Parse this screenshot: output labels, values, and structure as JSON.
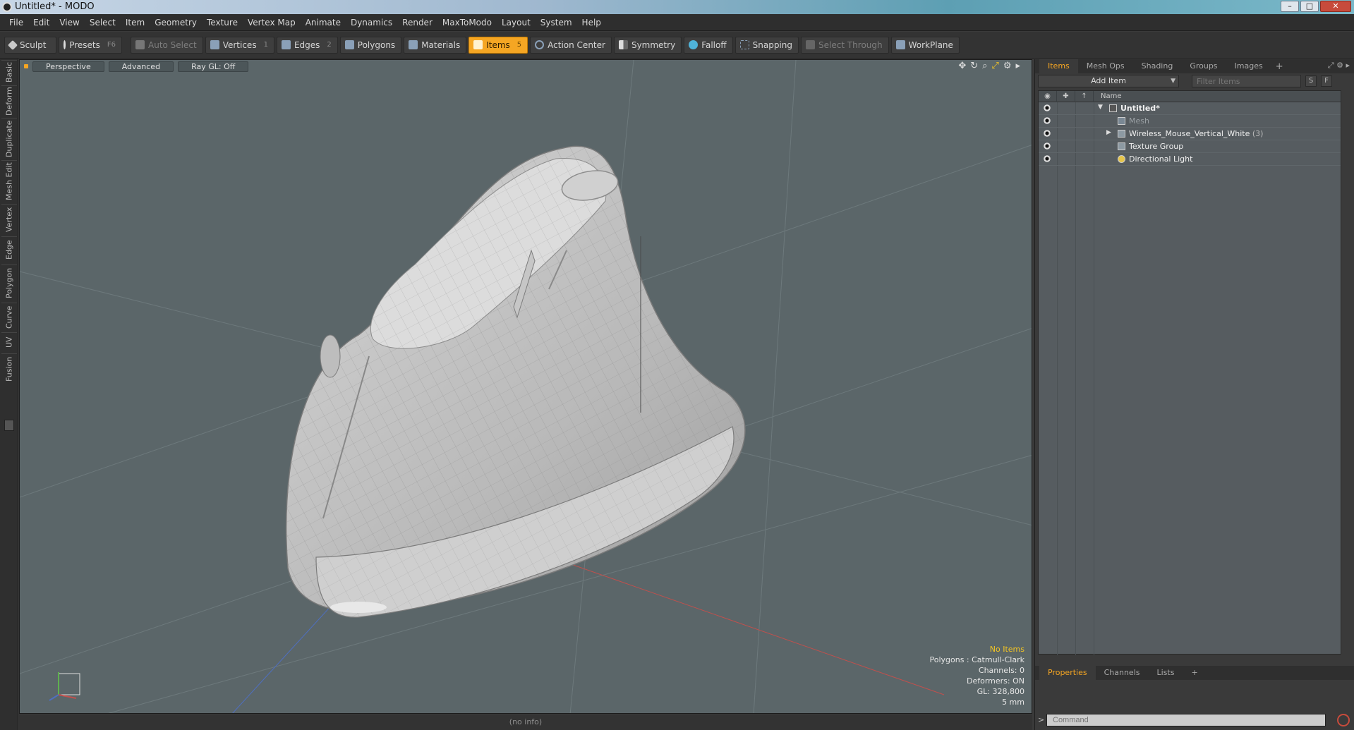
{
  "window": {
    "title": "Untitled* - MODO",
    "buttons": [
      "–",
      "□",
      "✕"
    ]
  },
  "menu": [
    "File",
    "Edit",
    "View",
    "Select",
    "Item",
    "Geometry",
    "Texture",
    "Vertex Map",
    "Animate",
    "Dynamics",
    "Render",
    "MaxToModo",
    "Layout",
    "System",
    "Help"
  ],
  "toolbar": {
    "sculpt": "Sculpt",
    "presets": "Presets",
    "presets_key": "F6",
    "auto_select": "Auto Select",
    "vertices": "Vertices",
    "vertices_key": "1",
    "edges": "Edges",
    "edges_key": "2",
    "polygons": "Polygons",
    "materials": "Materials",
    "items": "Items",
    "items_key": "5",
    "action_center": "Action Center",
    "symmetry": "Symmetry",
    "falloff": "Falloff",
    "snapping": "Snapping",
    "select_through": "Select Through",
    "workplane": "WorkPlane"
  },
  "left_tabs": [
    "Basic",
    "Deform",
    "Duplicate",
    "Mesh Edit",
    "Vertex",
    "Edge",
    "Polygon",
    "Curve",
    "UV",
    "Fusion"
  ],
  "viewport": {
    "view": "Perspective",
    "shading": "Advanced",
    "raygl": "Ray GL: Off",
    "tool_icons": [
      "✥",
      "↻",
      "⌕",
      "⤢",
      "⚙",
      "▸"
    ],
    "stats": {
      "items": "No Items",
      "polygons": "Polygons : Catmull-Clark",
      "channels": "Channels: 0",
      "deformers": "Deformers: ON",
      "gl": "GL: 328,800",
      "scale": "5 mm"
    },
    "accent": "#f5a623"
  },
  "infobar": "(no info)",
  "items_panel": {
    "tabs": [
      "Items",
      "Mesh Ops",
      "Shading",
      "Groups",
      "Images"
    ],
    "add_item": "Add Item",
    "filter_placeholder": "Filter Items",
    "s_btn": "S",
    "f_btn": "F",
    "name_col": "Name",
    "tree": [
      {
        "label": "Untitled*",
        "count": ""
      },
      {
        "label": "Mesh",
        "count": ""
      },
      {
        "label": "Wireless_Mouse_Vertical_White",
        "count": "(3)"
      },
      {
        "label": "Texture Group",
        "count": ""
      },
      {
        "label": "Directional Light",
        "count": ""
      }
    ]
  },
  "properties_panel": {
    "tabs": [
      "Properties",
      "Channels",
      "Lists"
    ],
    "command_placeholder": "Command"
  }
}
